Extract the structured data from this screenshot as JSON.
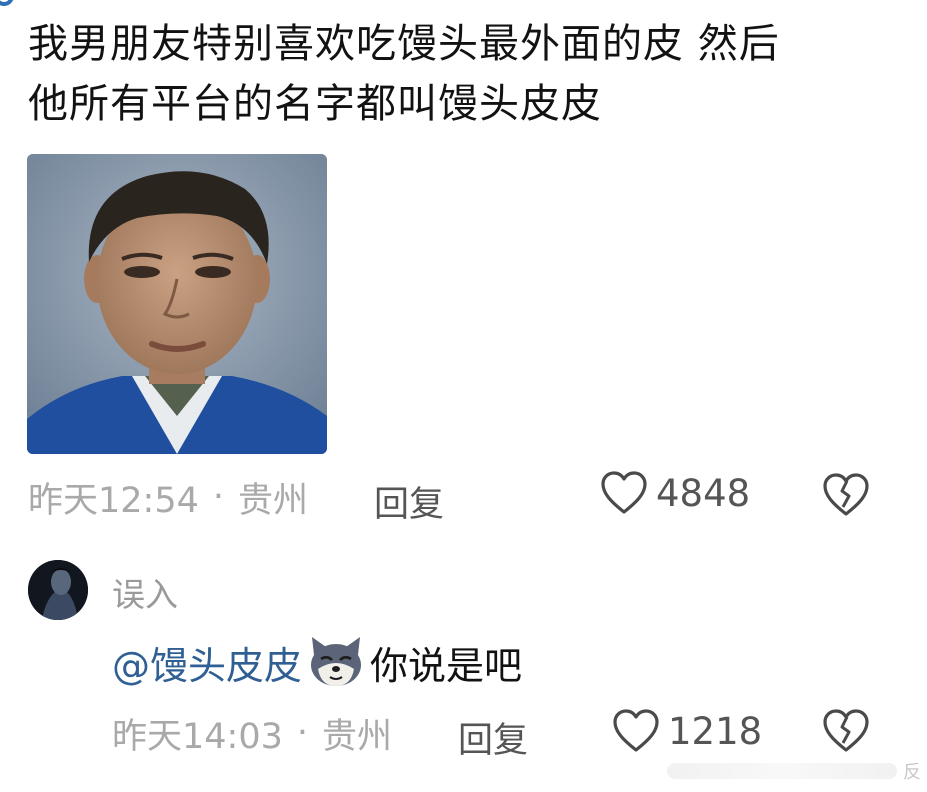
{
  "comment": {
    "text_line1": "我男朋友特别喜欢吃馒头最外面的皮 然后",
    "text_line2": "他所有平台的名字都叫馒头皮皮",
    "photo": "portrait-photo",
    "time": "昨天12:54",
    "separator": "·",
    "location": "贵州",
    "reply_label": "回复",
    "like_count": "4848"
  },
  "reply": {
    "username": "误入",
    "mention": "@馒头皮皮",
    "emoji": "wolf-dog-emoji",
    "text": "你说是吧",
    "time": "昨天14:03",
    "separator": "·",
    "location": "贵州",
    "reply_label": "回复",
    "like_count": "1218"
  },
  "watermark": {
    "text": "反"
  },
  "colors": {
    "mention": "#2f5f93",
    "meta": "#a9a9a9",
    "action": "#555555",
    "accent": "#2f6fb6"
  },
  "icons": [
    "heart-icon",
    "broken-heart-icon",
    "avatar"
  ]
}
